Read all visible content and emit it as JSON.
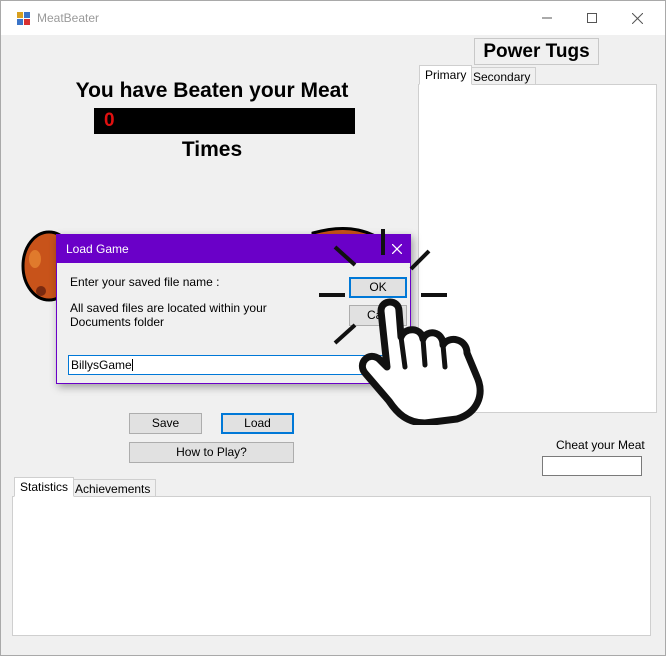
{
  "window": {
    "title": "MeatBeater",
    "controls": [
      "minimize-icon",
      "maximize-icon",
      "close-icon"
    ]
  },
  "header": {
    "power_tugs": "Power Tugs"
  },
  "counter": {
    "label_top": "You have Beaten your Meat",
    "value": "0",
    "label_bottom": "Times",
    "value_color": "#e01010"
  },
  "upgrades_tabs": {
    "tabs": [
      {
        "label": "Primary",
        "active": true
      },
      {
        "label": "Secondary",
        "active": false
      }
    ]
  },
  "buttons": {
    "save": "Save",
    "load": "Load",
    "how_to_play": "How to Play?"
  },
  "cheat": {
    "label": "Cheat your Meat",
    "value": ""
  },
  "stats_tabs": {
    "tabs": [
      {
        "label": "Statistics",
        "active": true
      },
      {
        "label": "Achievements",
        "active": false
      }
    ]
  },
  "dialog": {
    "title": "Load Game",
    "prompt": "Enter your saved file name :",
    "note": "All saved files are located within your Documents folder",
    "ok_label": "OK",
    "cancel_label": "Can",
    "input_value": "BillysGame",
    "accent_color": "#6a00c8"
  },
  "icons": {
    "app": "app-icon",
    "dialog_close": "close-icon",
    "pointer": "pointing-hand-click-icon",
    "meat": "meat-icon"
  }
}
